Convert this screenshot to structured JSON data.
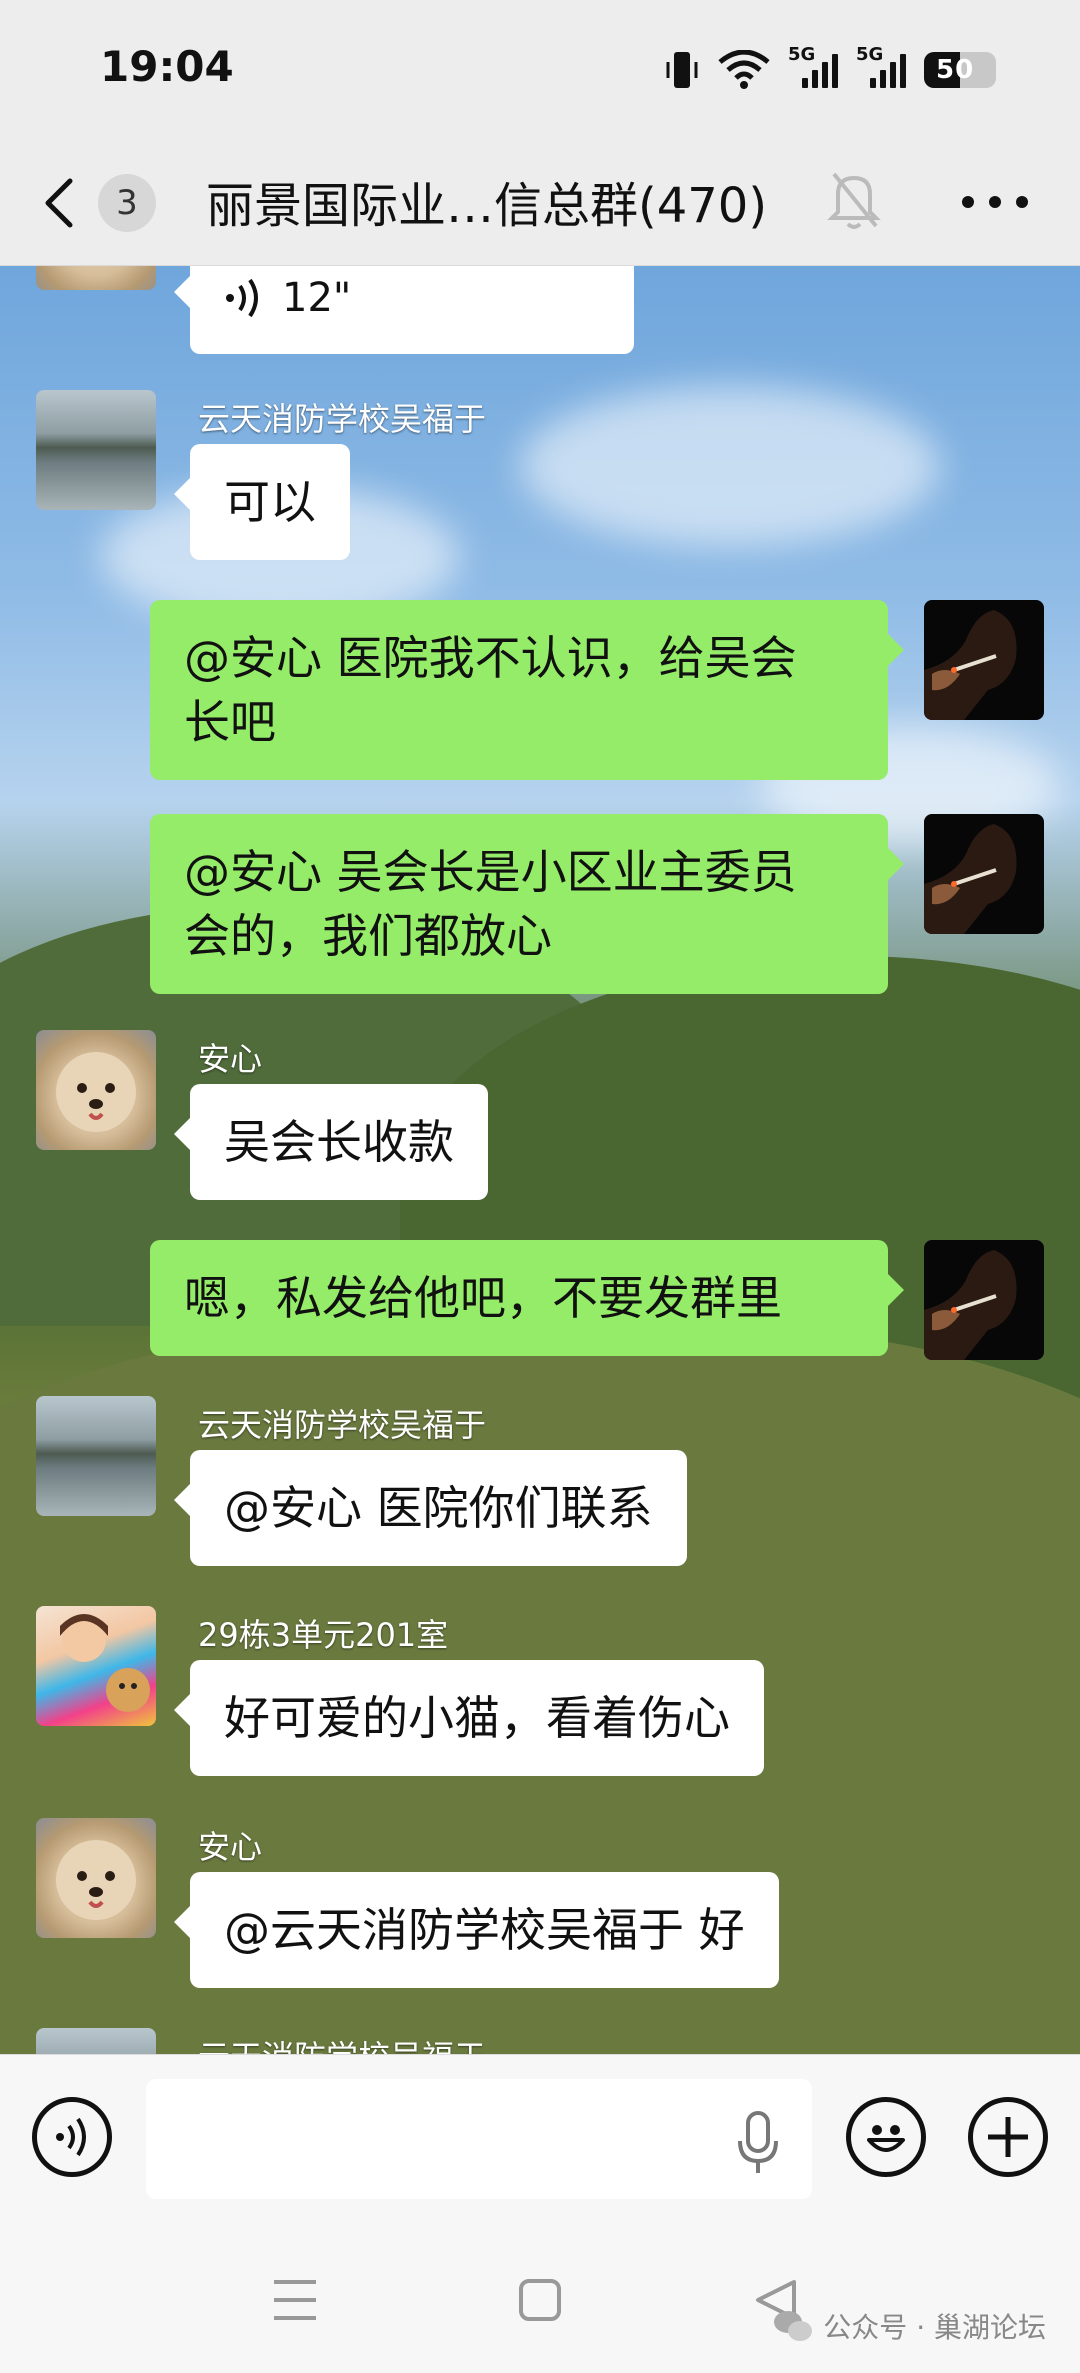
{
  "status_bar": {
    "time": "19:04",
    "network_1": "5G",
    "network_2": "5G",
    "battery": "50"
  },
  "header": {
    "unread_count": "3",
    "title": "丽景国际业…信总群(470)"
  },
  "messages": [
    {
      "side": "in",
      "type": "voice",
      "avatar": "lake",
      "duration": "12\""
    },
    {
      "side": "in",
      "sender": "云天消防学校吴福于",
      "avatar": "lake",
      "text": "可以"
    },
    {
      "side": "out",
      "avatar": "smoke",
      "lines": [
        "@安心  医院我不认识，给吴会",
        "长吧"
      ]
    },
    {
      "side": "out",
      "avatar": "smoke",
      "lines": [
        "@安心  吴会长是小区业主委员",
        "会的，我们都放心"
      ]
    },
    {
      "side": "in",
      "sender": "安心",
      "avatar": "dog",
      "text": "吴会长收款"
    },
    {
      "side": "out",
      "avatar": "smoke",
      "text": "嗯，私发给他吧，不要发群里"
    },
    {
      "side": "in",
      "sender": "云天消防学校吴福于",
      "avatar": "lake",
      "text": "@安心  医院你们联系"
    },
    {
      "side": "in",
      "sender": "29栋3单元201室",
      "avatar": "girl",
      "text": "好可爱的小猫，看着伤心"
    },
    {
      "side": "in",
      "sender": "安心",
      "avatar": "dog",
      "text": "@云天消防学校吴福于  好"
    },
    {
      "side": "in",
      "sender": "云天消防学校吴福于",
      "avatar": "lake",
      "partial": true
    }
  ],
  "input": {
    "placeholder": ""
  },
  "watermark": "公众号 · 巢湖论坛",
  "icons": {
    "back": "chevron-left-icon",
    "mute": "bell-off-icon",
    "more": "more-dots-icon",
    "voice": "voice-wave-icon",
    "mic": "microphone-icon",
    "emoji": "smiley-icon",
    "plus": "plus-icon"
  },
  "colors": {
    "outgoing_bubble": "#95ec69",
    "incoming_bubble": "#ffffff",
    "bar_background": "#ededed"
  }
}
